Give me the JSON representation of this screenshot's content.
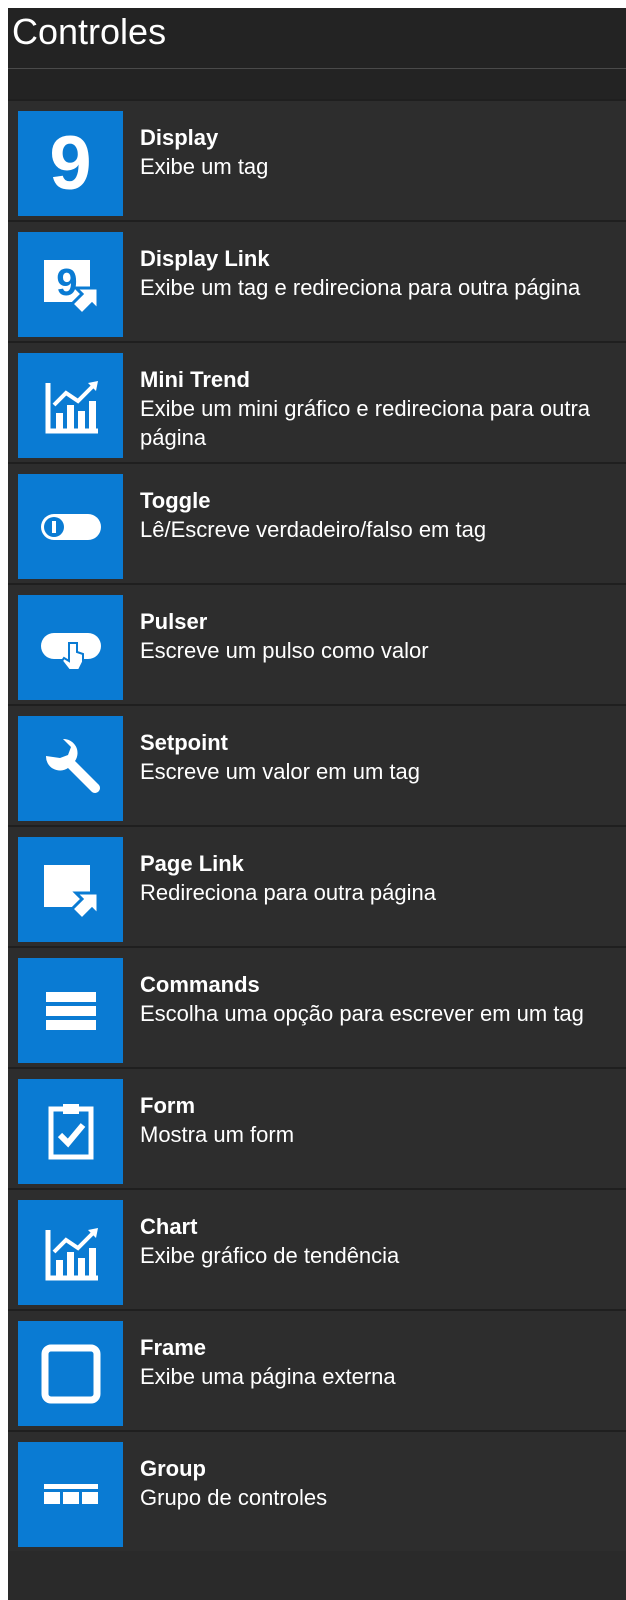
{
  "panel": {
    "title": "Controles"
  },
  "colors": {
    "tile": "#0a7bd3",
    "background": "#2d2d2d",
    "text": "#ffffff"
  },
  "controls": [
    {
      "name": "Display",
      "description": "Exibe um tag",
      "icon": "display-nine-icon",
      "glyph": "9"
    },
    {
      "name": "Display Link",
      "description": "Exibe um tag e redireciona para outra página",
      "icon": "display-link-icon",
      "glyph": "9"
    },
    {
      "name": "Mini Trend",
      "description": "Exibe um mini gráfico e redireciona para outra página",
      "icon": "trend-chart-icon"
    },
    {
      "name": "Toggle",
      "description": "Lê/Escreve verdadeiro/falso em tag",
      "icon": "toggle-switch-icon"
    },
    {
      "name": "Pulser",
      "description": "Escreve um pulso como valor",
      "icon": "pulser-hand-icon"
    },
    {
      "name": "Setpoint",
      "description": "Escreve um valor em um tag",
      "icon": "wrench-icon"
    },
    {
      "name": "Page Link",
      "description": "Redireciona para outra página",
      "icon": "page-link-icon"
    },
    {
      "name": "Commands",
      "description": "Escolha uma opção para escrever em um tag",
      "icon": "list-bars-icon"
    },
    {
      "name": "Form",
      "description": "Mostra um form",
      "icon": "clipboard-check-icon"
    },
    {
      "name": "Chart",
      "description": "Exibe gráfico de tendência",
      "icon": "chart-icon"
    },
    {
      "name": "Frame",
      "description": "Exibe uma página externa",
      "icon": "frame-square-icon"
    },
    {
      "name": "Group",
      "description": "Grupo de controles",
      "icon": "group-table-icon"
    }
  ]
}
